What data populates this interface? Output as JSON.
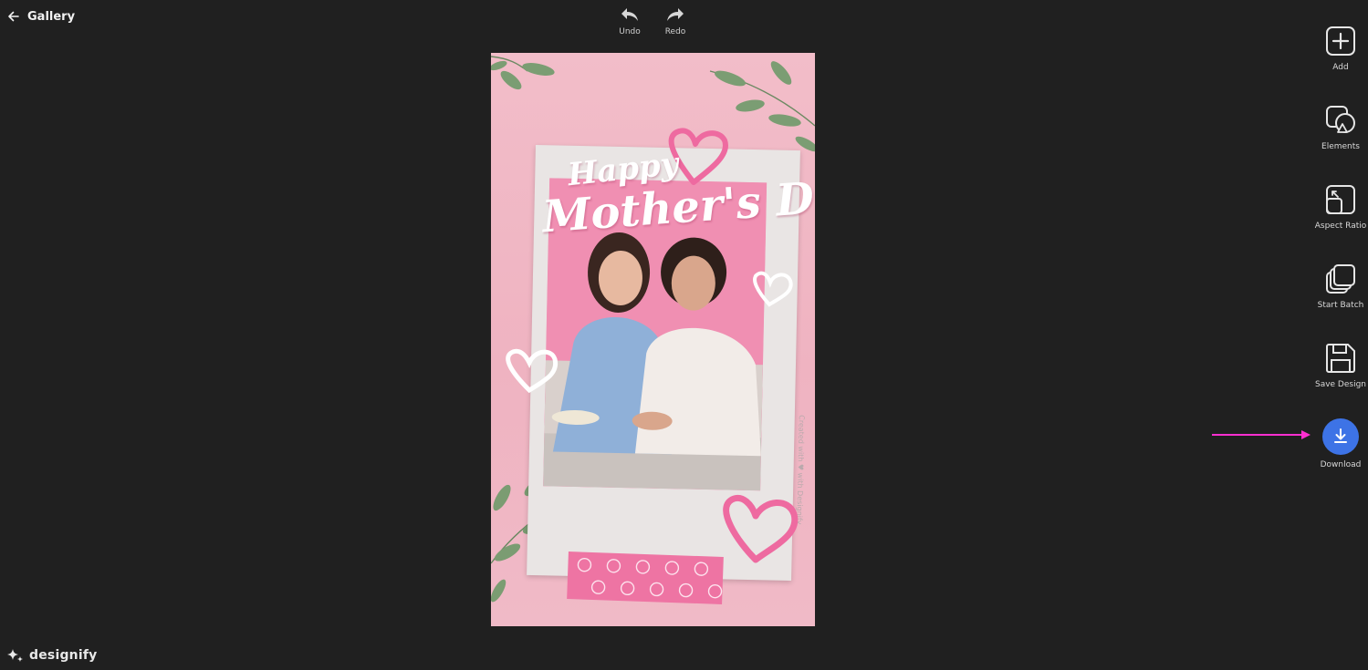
{
  "header": {
    "back_label": "Gallery",
    "undo_label": "Undo",
    "redo_label": "Redo"
  },
  "canvas": {
    "title_line1": "Happy",
    "title_line2": "Mother's Day",
    "credit_text": "Created with ♥ with Designify"
  },
  "toolbar": {
    "items": [
      {
        "label": "Add",
        "icon": "plus-square-icon"
      },
      {
        "label": "Elements",
        "icon": "shapes-icon"
      },
      {
        "label": "Aspect Ratio",
        "icon": "aspect-ratio-icon"
      },
      {
        "label": "Start Batch",
        "icon": "layers-icon"
      },
      {
        "label": "Save Design",
        "icon": "floppy-disk-icon"
      },
      {
        "label": "Download",
        "icon": "download-icon"
      }
    ]
  },
  "brand": {
    "name": "designify"
  },
  "colors": {
    "background": "#202020",
    "accent_download": "#3d73e6",
    "annotation_arrow": "#ff2fd0",
    "canvas_pink": "#f2bdc9",
    "heart_pink": "#ee6aa0"
  }
}
